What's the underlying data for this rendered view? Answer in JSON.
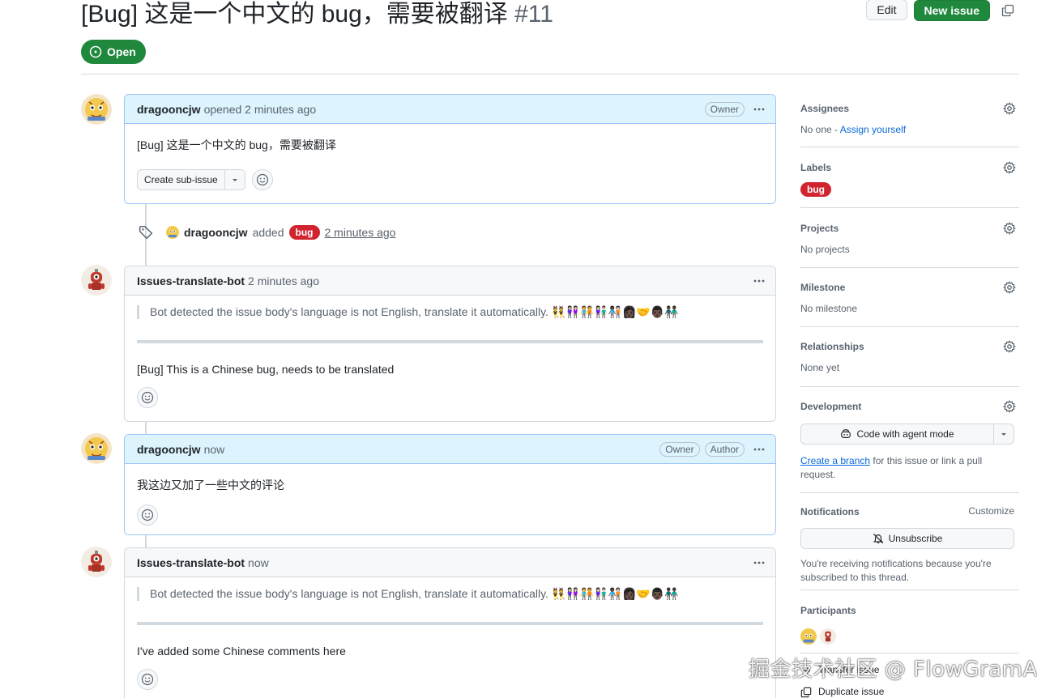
{
  "issue": {
    "title": "[Bug] 这是一个中文的 bug，需要被翻译",
    "number": "#11",
    "state": "Open"
  },
  "header": {
    "edit_label": "Edit",
    "new_issue_label": "New issue"
  },
  "comments": [
    {
      "author": "dragooncjw",
      "action": "opened",
      "time": "2 minutes ago",
      "badges": [
        "Owner"
      ],
      "body": "[Bug] 这是一个中文的 bug，需要被翻译",
      "sub_issue_label": "Create sub-issue"
    },
    {
      "author": "Issues-translate-bot",
      "time": "2 minutes ago",
      "quote": "Bot detected the issue body's language is not English, translate it automatically. 👯👭🏻🧑‍🤝‍🧑👫🏻🧑🏿‍🤝‍🧑🏻👩🏿‍🤝‍👨🏿👬🏿",
      "body": "[Bug] This is a Chinese bug, needs to be translated"
    },
    {
      "author": "dragooncjw",
      "time": "now",
      "badges": [
        "Owner",
        "Author"
      ],
      "body": "我这边又加了一些中文的评论"
    },
    {
      "author": "Issues-translate-bot",
      "time": "now",
      "quote": "Bot detected the issue body's language is not English, translate it automatically. 👯👭🏻🧑‍🤝‍🧑👫🏻🧑🏿‍🤝‍🧑🏻👩🏿‍🤝‍👨🏿👬🏿",
      "body": "I've added some Chinese comments here"
    }
  ],
  "label_event": {
    "author": "dragooncjw",
    "action": "added",
    "label": "bug",
    "time": "2 minutes ago"
  },
  "sidebar": {
    "assignees": {
      "title": "Assignees",
      "text": "No one -",
      "link": "Assign yourself"
    },
    "labels": {
      "title": "Labels",
      "items": [
        "bug"
      ]
    },
    "projects": {
      "title": "Projects",
      "text": "No projects"
    },
    "milestone": {
      "title": "Milestone",
      "text": "No milestone"
    },
    "relationships": {
      "title": "Relationships",
      "text": "None yet"
    },
    "development": {
      "title": "Development",
      "button": "Code with agent mode",
      "link": "Create a branch",
      "text": "for this issue or link a pull request."
    },
    "notifications": {
      "title": "Notifications",
      "customize": "Customize",
      "button": "Unsubscribe",
      "text": "You're receiving notifications because you're subscribed to this thread."
    },
    "participants": {
      "title": "Participants"
    },
    "transfer": "Transfer issue",
    "duplicate": "Duplicate issue"
  },
  "watermark": "掘金技术社区 @ FlowGramAI",
  "colors": {
    "green": "#1f883d",
    "bug_label": "#d1242f",
    "link": "#0969da",
    "owner_header": "#ddf4ff"
  }
}
